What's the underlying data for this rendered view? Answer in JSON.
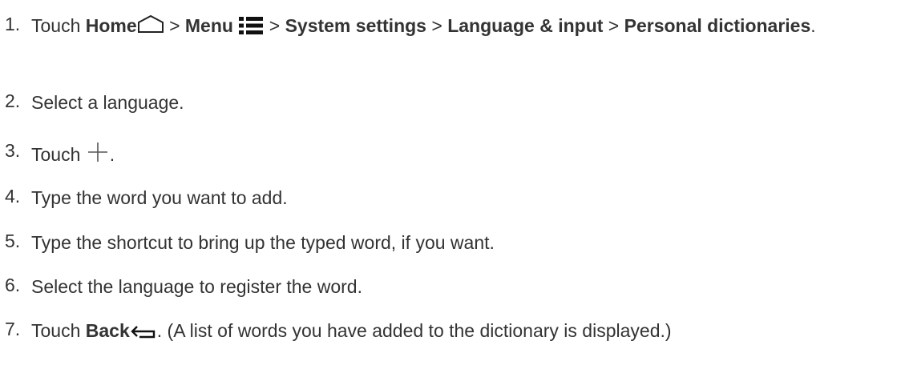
{
  "steps": [
    {
      "number": "1.",
      "touch": "Touch",
      "home": "Home",
      "sep": ">",
      "menu": "Menu",
      "system_settings": "System settings",
      "language_input": "Language & input",
      "personal_dictionaries": "Personal dictionaries",
      "end": ".",
      "icons": [
        "home-icon",
        "menu-icon"
      ]
    },
    {
      "number": "2.",
      "text": "Select a language."
    },
    {
      "number": "3.",
      "touch": "Touch",
      "end": ".",
      "icons": [
        "plus-icon"
      ]
    },
    {
      "number": "4.",
      "text": "Type the word you want to add."
    },
    {
      "number": "5.",
      "text": "Type the shortcut to bring up the typed word, if you want."
    },
    {
      "number": "6.",
      "text": "Select the language to register the word."
    },
    {
      "number": "7.",
      "touch": "Touch",
      "back": "Back",
      "after": ". (A list of words you have added to the dictionary is displayed.)",
      "icons": [
        "back-icon"
      ]
    }
  ]
}
